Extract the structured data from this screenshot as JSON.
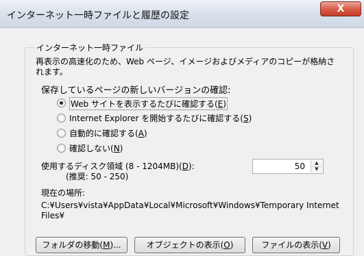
{
  "window": {
    "title": "インターネット一時ファイルと履歴の設定",
    "close_glyph": "X"
  },
  "group": {
    "legend": "インターネット一時ファイル",
    "description_line1": "再表示の高速化のため、Web ページ、イメージおよびメディアのコピーが格納さ",
    "description_line2": "れます。",
    "check_heading": "保存しているページの新しいバージョンの確認:",
    "options": [
      {
        "label": "Web サイトを表示するたびに確認する(",
        "accel": "E",
        "suffix": ")",
        "checked": true
      },
      {
        "label": "Internet Explorer を開始するたびに確認する(",
        "accel": "S",
        "suffix": ")",
        "checked": false
      },
      {
        "label": "自動的に確認する(",
        "accel": "A",
        "suffix": ")",
        "checked": false
      },
      {
        "label": "確認しない(",
        "accel": "N",
        "suffix": ")",
        "checked": false
      }
    ],
    "disk_label_prefix": "使用するディスク領域 (8 - 1204MB)(",
    "disk_label_accel": "D",
    "disk_label_suffix": "):",
    "disk_recommend": "(推奨: 50 - 250)",
    "disk_value": "50",
    "location_label": "現在の場所:",
    "location_line1": "C:¥Users¥vista¥AppData¥Local¥Microsoft¥Windows¥Temporary Internet",
    "location_line2": "Files¥"
  },
  "buttons": {
    "move_folder": {
      "prefix": "フォルダの移動(",
      "accel": "M",
      "suffix": ")..."
    },
    "view_objects": {
      "prefix": "オブジェクトの表示(",
      "accel": "O",
      "suffix": ")"
    },
    "view_files": {
      "prefix": "ファイルの表示(",
      "accel": "V",
      "suffix": ")"
    }
  }
}
